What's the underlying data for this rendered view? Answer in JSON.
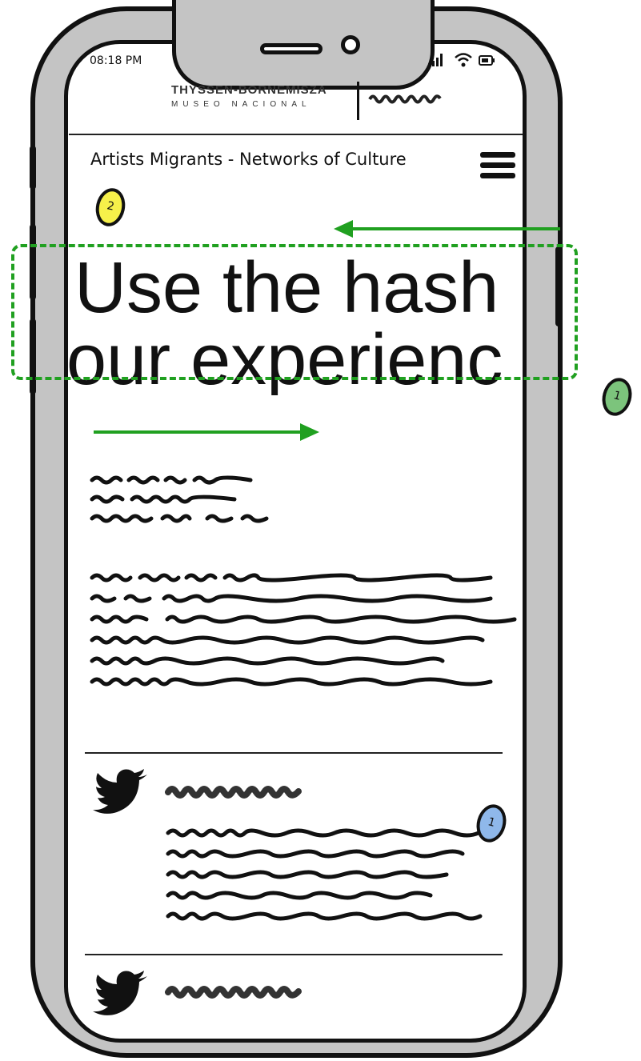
{
  "status_bar": {
    "time": "08:18 PM",
    "signal_icon": "signal-bars-icon",
    "wifi_icon": "wifi-icon",
    "battery_icon": "battery-icon"
  },
  "logo": {
    "line1": "THYSSEN-BORNEMISZA",
    "line2": "MUSEO NACIONAL"
  },
  "nav": {
    "title": "Artists Migrants - Networks of Culture",
    "menu_icon": "hamburger-menu-icon"
  },
  "hero": {
    "line1": "Use the hash",
    "line2": "our experienc"
  },
  "annotations": {
    "marker_2": "2",
    "marker_1_outside": "1",
    "marker_1_tweet": "1"
  },
  "colors": {
    "accent_green": "#20a020",
    "marker_yellow": "#f6f04a",
    "marker_green": "#7cc47c",
    "marker_blue": "#8fb8ea",
    "frame_gray": "#c4c4c4"
  },
  "tweets_icon": "twitter-bird-icon"
}
